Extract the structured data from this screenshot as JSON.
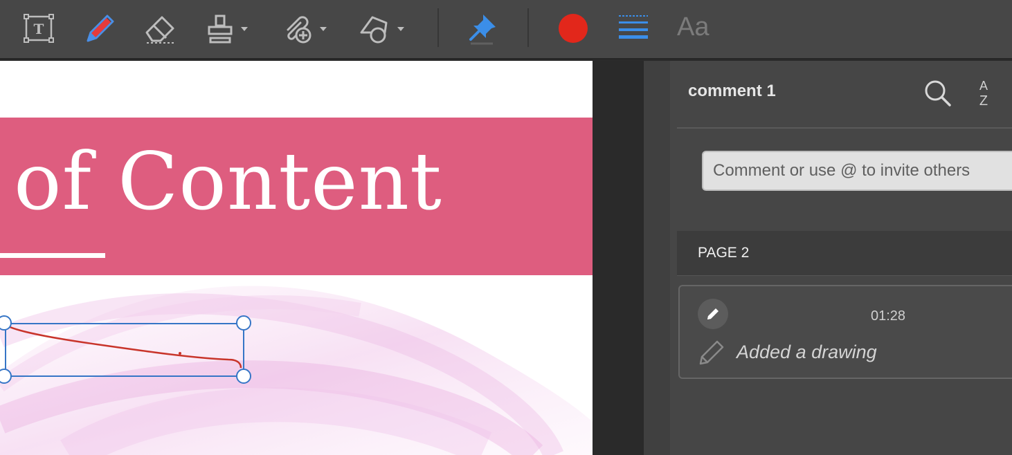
{
  "toolbar": {
    "tools": [
      {
        "name": "add-text-box-icon",
        "interactable": true
      },
      {
        "name": "draw-pencil-icon",
        "interactable": true
      },
      {
        "name": "eraser-icon",
        "interactable": true
      },
      {
        "name": "stamp-icon",
        "interactable": true
      },
      {
        "name": "attach-file-icon",
        "interactable": true
      },
      {
        "name": "shapes-icon",
        "interactable": true
      },
      {
        "name": "pin-note-icon",
        "interactable": true
      },
      {
        "name": "color-picker",
        "interactable": true
      },
      {
        "name": "line-thickness-icon",
        "interactable": true
      }
    ],
    "font_label": "Aa",
    "colors": {
      "pencil": "#4a8fe6",
      "pin": "#3b8ee8",
      "current_color": "#e2271b",
      "line": "#3b8ee8"
    }
  },
  "document": {
    "title": "of Content",
    "banner_color": "#de5d7f",
    "drawing_color": "#c8342a",
    "selection_color": "#3575c6"
  },
  "comments_panel": {
    "title": "comment 1",
    "search_icon": "search-icon",
    "sort_icon": "sort-az-icon",
    "sort_label_top": "A",
    "sort_label_bottom": "Z",
    "comment_placeholder": "Comment or use @ to invite others",
    "page_label": "PAGE 2",
    "entries": [
      {
        "time": "01:28",
        "text": "Added a drawing",
        "icon": "pencil-icon"
      }
    ]
  }
}
